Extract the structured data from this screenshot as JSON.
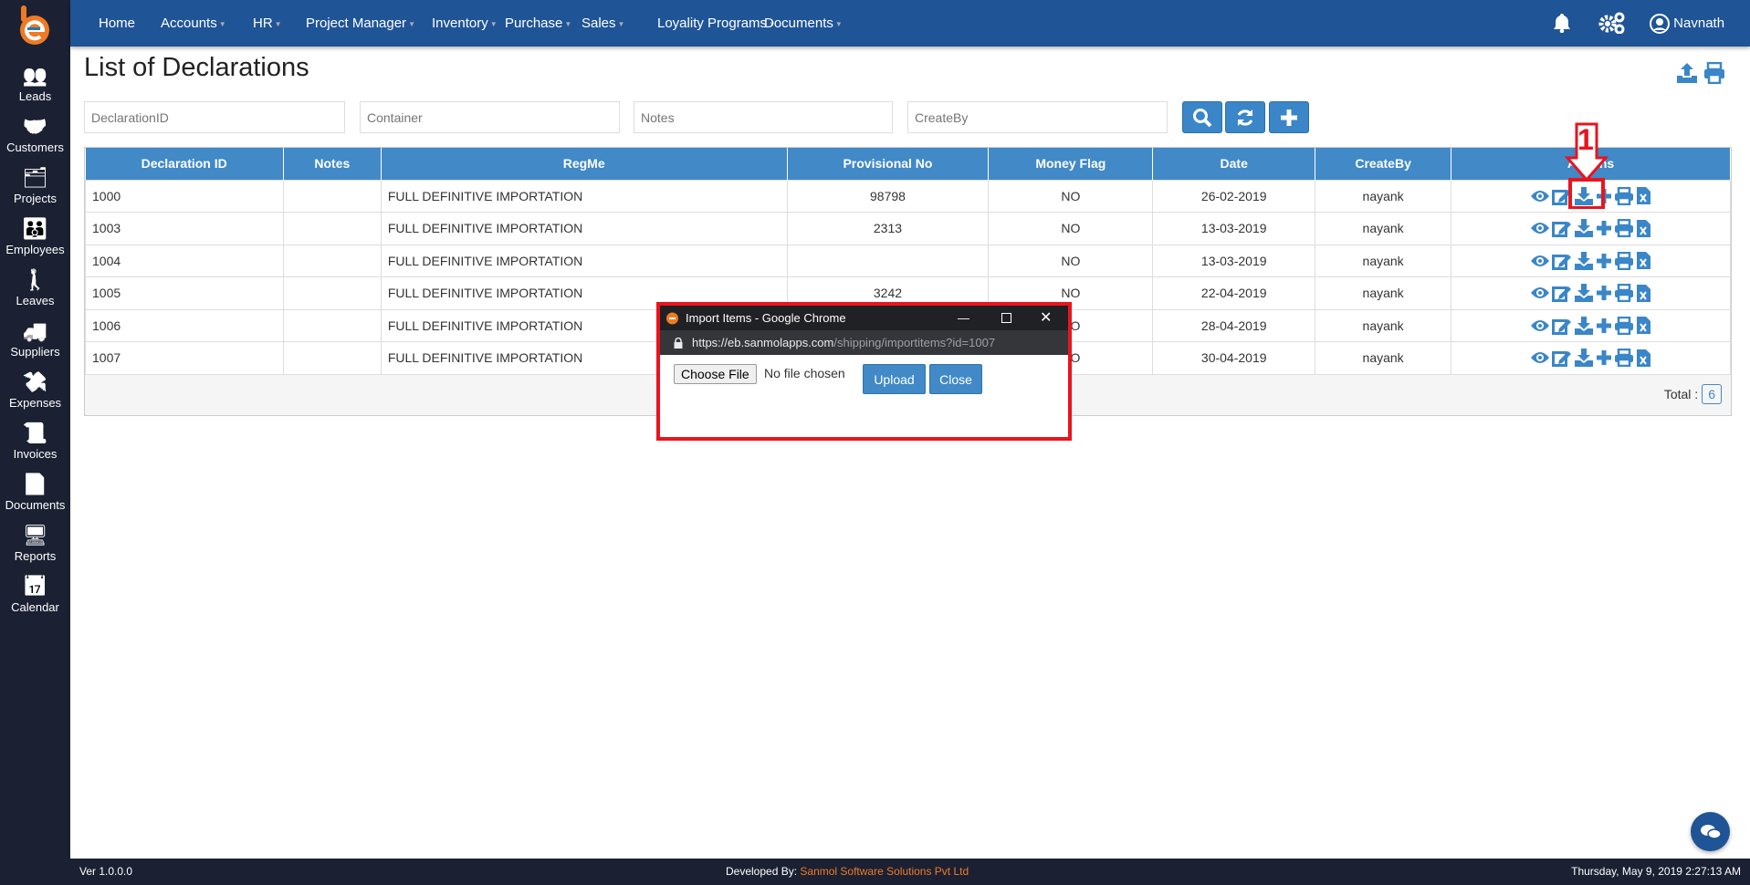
{
  "sidebar": {
    "items": [
      {
        "label": "Leads",
        "icon": "leads-icon"
      },
      {
        "label": "Customers",
        "icon": "customers-icon"
      },
      {
        "label": "Projects",
        "icon": "projects-icon"
      },
      {
        "label": "Employees",
        "icon": "employees-icon"
      },
      {
        "label": "Leaves",
        "icon": "leaves-icon"
      },
      {
        "label": "Suppliers",
        "icon": "suppliers-icon"
      },
      {
        "label": "Expenses",
        "icon": "expenses-icon"
      },
      {
        "label": "Invoices",
        "icon": "invoices-icon"
      },
      {
        "label": "Documents",
        "icon": "documents-icon"
      },
      {
        "label": "Reports",
        "icon": "reports-icon"
      },
      {
        "label": "Calendar",
        "icon": "calendar-icon"
      }
    ]
  },
  "topnav": {
    "items": [
      "Home",
      "Accounts",
      "HR",
      "Project Manager",
      "Inventory",
      "Purchase",
      "Sales",
      "Loyality Programs",
      "Documents"
    ],
    "user": "Navnath"
  },
  "page": {
    "title": "List of Declarations"
  },
  "filters": {
    "declaration_id": "DeclarationID",
    "container": "Container",
    "notes": "Notes",
    "create_by": "CreateBy"
  },
  "table": {
    "headers": [
      "Declaration ID",
      "Notes",
      "RegMe",
      "Provisional No",
      "Money Flag",
      "Date",
      "CreateBy",
      "Actions"
    ],
    "rows": [
      [
        "1000",
        "",
        "FULL DEFINITIVE IMPORTATION",
        "98798",
        "NO",
        "26-02-2019",
        "nayank"
      ],
      [
        "1003",
        "",
        "FULL DEFINITIVE IMPORTATION",
        "2313",
        "NO",
        "13-03-2019",
        "nayank"
      ],
      [
        "1004",
        "",
        "FULL DEFINITIVE IMPORTATION",
        "",
        "NO",
        "13-03-2019",
        "nayank"
      ],
      [
        "1005",
        "",
        "FULL DEFINITIVE IMPORTATION",
        "3242",
        "NO",
        "22-04-2019",
        "nayank"
      ],
      [
        "1006",
        "",
        "FULL DEFINITIVE IMPORTATION",
        "",
        "NO",
        "28-04-2019",
        "nayank"
      ],
      [
        "1007",
        "",
        "FULL DEFINITIVE IMPORTATION",
        "",
        "NO",
        "30-04-2019",
        "nayank"
      ]
    ],
    "total_label": "Total :",
    "total": "6"
  },
  "annotation": {
    "step": "1"
  },
  "dialog": {
    "title": "Import Items - Google Chrome",
    "url_host": "https://eb.sanmolapps.com",
    "url_path": "/shipping/importitems?id=1007",
    "choose_file": "Choose File",
    "no_file": "No file chosen",
    "upload": "Upload",
    "close": "Close"
  },
  "footer": {
    "version": "Ver 1.0.0.0",
    "developed_by": "Developed By:",
    "company": "Sanmol Software Solutions Pvt Ltd",
    "datetime": "Thursday, May 9, 2019 2:27:13 AM"
  },
  "colors": {
    "primary": "#1f5496",
    "accent": "#4189c7",
    "sidebar": "#1b2133",
    "annotation": "#e8141e",
    "brand": "#f07a24"
  }
}
